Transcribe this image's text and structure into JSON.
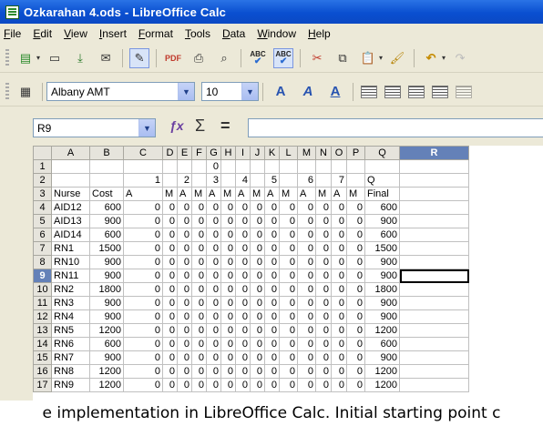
{
  "window": {
    "title": "Ozkarahan 4.ods - LibreOffice Calc"
  },
  "menu": [
    "File",
    "Edit",
    "View",
    "Insert",
    "Format",
    "Tools",
    "Data",
    "Window",
    "Help"
  ],
  "toolbar_format": {
    "font_name": "Albany AMT",
    "font_size": "10"
  },
  "formula_bar": {
    "cell_reference": "R9",
    "content": ""
  },
  "sheet": {
    "columns": [
      "A",
      "B",
      "C",
      "D",
      "E",
      "F",
      "G",
      "H",
      "I",
      "J",
      "K",
      "L",
      "M",
      "N",
      "O",
      "P",
      "Q",
      "R"
    ],
    "selected_column": "R",
    "selected_row": "9",
    "rows": [
      {
        "n": "1",
        "cells": [
          "",
          "",
          "",
          "",
          "",
          "",
          "0",
          "",
          "",
          "",
          "",
          "",
          "",
          "",
          "",
          "",
          "",
          ""
        ]
      },
      {
        "n": "2",
        "cells": [
          "",
          "",
          "1",
          "",
          "2",
          "",
          "3",
          "",
          "4",
          "",
          "5",
          "",
          "6",
          "",
          "7",
          "",
          "Q",
          ""
        ]
      },
      {
        "n": "3",
        "cells": [
          "Nurse",
          "Cost",
          "A",
          "M",
          "A",
          "M",
          "A",
          "M",
          "A",
          "M",
          "A",
          "M",
          "A",
          "M",
          "A",
          "M",
          "Final",
          ""
        ]
      },
      {
        "n": "4",
        "cells": [
          "AID12",
          "600",
          "0",
          "0",
          "0",
          "0",
          "0",
          "0",
          "0",
          "0",
          "0",
          "0",
          "0",
          "0",
          "0",
          "0",
          "600",
          ""
        ]
      },
      {
        "n": "5",
        "cells": [
          "AID13",
          "900",
          "0",
          "0",
          "0",
          "0",
          "0",
          "0",
          "0",
          "0",
          "0",
          "0",
          "0",
          "0",
          "0",
          "0",
          "900",
          ""
        ]
      },
      {
        "n": "6",
        "cells": [
          "AID14",
          "600",
          "0",
          "0",
          "0",
          "0",
          "0",
          "0",
          "0",
          "0",
          "0",
          "0",
          "0",
          "0",
          "0",
          "0",
          "600",
          ""
        ]
      },
      {
        "n": "7",
        "cells": [
          "RN1",
          "1500",
          "0",
          "0",
          "0",
          "0",
          "0",
          "0",
          "0",
          "0",
          "0",
          "0",
          "0",
          "0",
          "0",
          "0",
          "1500",
          ""
        ]
      },
      {
        "n": "8",
        "cells": [
          "RN10",
          "900",
          "0",
          "0",
          "0",
          "0",
          "0",
          "0",
          "0",
          "0",
          "0",
          "0",
          "0",
          "0",
          "0",
          "0",
          "900",
          ""
        ]
      },
      {
        "n": "9",
        "cells": [
          "RN11",
          "900",
          "0",
          "0",
          "0",
          "0",
          "0",
          "0",
          "0",
          "0",
          "0",
          "0",
          "0",
          "0",
          "0",
          "0",
          "900",
          ""
        ]
      },
      {
        "n": "10",
        "cells": [
          "RN2",
          "1800",
          "0",
          "0",
          "0",
          "0",
          "0",
          "0",
          "0",
          "0",
          "0",
          "0",
          "0",
          "0",
          "0",
          "0",
          "1800",
          ""
        ]
      },
      {
        "n": "11",
        "cells": [
          "RN3",
          "900",
          "0",
          "0",
          "0",
          "0",
          "0",
          "0",
          "0",
          "0",
          "0",
          "0",
          "0",
          "0",
          "0",
          "0",
          "900",
          ""
        ]
      },
      {
        "n": "12",
        "cells": [
          "RN4",
          "900",
          "0",
          "0",
          "0",
          "0",
          "0",
          "0",
          "0",
          "0",
          "0",
          "0",
          "0",
          "0",
          "0",
          "0",
          "900",
          ""
        ]
      },
      {
        "n": "13",
        "cells": [
          "RN5",
          "1200",
          "0",
          "0",
          "0",
          "0",
          "0",
          "0",
          "0",
          "0",
          "0",
          "0",
          "0",
          "0",
          "0",
          "0",
          "1200",
          ""
        ]
      },
      {
        "n": "14",
        "cells": [
          "RN6",
          "600",
          "0",
          "0",
          "0",
          "0",
          "0",
          "0",
          "0",
          "0",
          "0",
          "0",
          "0",
          "0",
          "0",
          "0",
          "600",
          ""
        ]
      },
      {
        "n": "15",
        "cells": [
          "RN7",
          "900",
          "0",
          "0",
          "0",
          "0",
          "0",
          "0",
          "0",
          "0",
          "0",
          "0",
          "0",
          "0",
          "0",
          "0",
          "900",
          ""
        ]
      },
      {
        "n": "16",
        "cells": [
          "RN8",
          "1200",
          "0",
          "0",
          "0",
          "0",
          "0",
          "0",
          "0",
          "0",
          "0",
          "0",
          "0",
          "0",
          "0",
          "0",
          "1200",
          ""
        ]
      },
      {
        "n": "17",
        "cells": [
          "RN9",
          "1200",
          "0",
          "0",
          "0",
          "0",
          "0",
          "0",
          "0",
          "0",
          "0",
          "0",
          "0",
          "0",
          "0",
          "0",
          "1200",
          ""
        ]
      }
    ]
  },
  "caption": "e implementation in LibreOffice Calc. Initial starting point c"
}
